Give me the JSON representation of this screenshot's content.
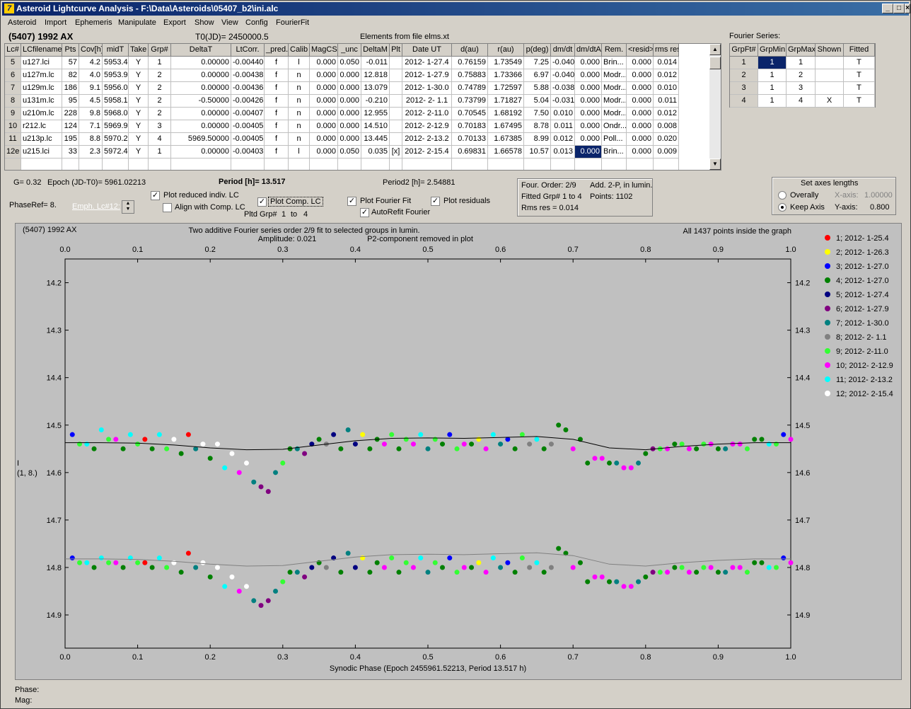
{
  "window": {
    "title": "Asteroid Lightcurve Analysis - F:\\Data\\Asteroids\\05407_b2\\ini.alc",
    "icon_name": "app-icon",
    "minimize": "_",
    "maximize": "□",
    "close": "×"
  },
  "menu": [
    "Asteroid",
    "Import",
    "Ephemeris",
    "Manipulate",
    "Export",
    "Show",
    "View",
    "Config",
    "FourierFit"
  ],
  "header": {
    "asteroid": "(5407) 1992 AX",
    "t0": "T0(JD)= 2450000.5",
    "elements": "Elements from file elms.xt",
    "fourier_series_label": "Fourier Series:"
  },
  "table": {
    "columns": [
      "Lc#",
      "LCfilename",
      "Pts",
      "Cov[h]",
      "midT",
      "Take",
      "Grp#",
      "DeltaT",
      "LtCorr.",
      "_pred.",
      "Calib",
      "MagCS",
      "_unc",
      "DeltaM",
      "Plt",
      "Date UT",
      "d(au)",
      "r(au)",
      "p(deg)",
      "dm/dt",
      "dm/dtA",
      "Rem.",
      "<resid>",
      "rms res"
    ],
    "rows": [
      [
        "5",
        "u127.lci",
        "57",
        "4.2",
        "5953.4",
        "Y",
        "1",
        "0.00000",
        "-0.00440",
        "f",
        "l",
        "0.000",
        "0.050",
        "-0.011",
        "",
        "2012- 1-27.4",
        "0.76159",
        "1.73549",
        "7.25",
        "-0.040",
        "0.000",
        "Brin...",
        "0.000",
        "0.014"
      ],
      [
        "6",
        "u127m.lc",
        "82",
        "4.0",
        "5953.9",
        "Y",
        "2",
        "0.00000",
        "-0.00438",
        "f",
        "n",
        "0.000",
        "0.000",
        "12.818",
        "",
        "2012- 1-27.9",
        "0.75883",
        "1.73366",
        "6.97",
        "-0.040",
        "0.000",
        "Modr...",
        "0.000",
        "0.012"
      ],
      [
        "7",
        "u129m.lc",
        "186",
        "9.1",
        "5956.0",
        "Y",
        "2",
        "0.00000",
        "-0.00436",
        "f",
        "n",
        "0.000",
        "0.000",
        "13.079",
        "",
        "2012- 1-30.0",
        "0.74789",
        "1.72597",
        "5.88",
        "-0.038",
        "0.000",
        "Modr...",
        "0.000",
        "0.010"
      ],
      [
        "8",
        "u131m.lc",
        "95",
        "4.5",
        "5958.1",
        "Y",
        "2",
        "-0.50000",
        "-0.00426",
        "f",
        "n",
        "0.000",
        "0.000",
        "-0.210",
        "",
        "2012- 2- 1.1",
        "0.73799",
        "1.71827",
        "5.04",
        "-0.031",
        "0.000",
        "Modr...",
        "0.000",
        "0.011"
      ],
      [
        "9",
        "u210m.lc",
        "228",
        "9.8",
        "5968.0",
        "Y",
        "2",
        "0.00000",
        "-0.00407",
        "f",
        "n",
        "0.000",
        "0.000",
        "12.955",
        "",
        "2012- 2-11.0",
        "0.70545",
        "1.68192",
        "7.50",
        "0.010",
        "0.000",
        "Modr...",
        "0.000",
        "0.012"
      ],
      [
        "10",
        "r212.lc",
        "124",
        "7.1",
        "5969.9",
        "Y",
        "3",
        "0.00000",
        "-0.00405",
        "f",
        "n",
        "0.000",
        "0.000",
        "14.510",
        "",
        "2012- 2-12.9",
        "0.70183",
        "1.67495",
        "8.78",
        "0.011",
        "0.000",
        "Ondr...",
        "0.000",
        "0.008"
      ],
      [
        "11",
        "u213p.lc",
        "195",
        "8.8",
        "5970.2",
        "Y",
        "4",
        "5969.50000",
        "-0.00405",
        "f",
        "n",
        "0.000",
        "0.000",
        "13.445",
        "",
        "2012- 2-13.2",
        "0.70133",
        "1.67385",
        "8.99",
        "0.012",
        "0.000",
        "Poll...",
        "0.000",
        "0.020"
      ],
      [
        "12e",
        "u215.lci",
        "33",
        "2.3",
        "5972.4",
        "Y",
        "1",
        "0.00000",
        "-0.00403",
        "f",
        "l",
        "0.000",
        "0.050",
        "0.035",
        "[x]",
        "2012- 2-15.4",
        "0.69831",
        "1.66578",
        "10.57",
        "0.013",
        "0.000",
        "Brin...",
        "0.000",
        "0.009"
      ]
    ]
  },
  "fourier": {
    "columns": [
      "GrpFt#",
      "GrpMin",
      "GrpMax",
      "Shown",
      "Fitted"
    ],
    "rows": [
      [
        "1",
        "1",
        "1",
        "",
        "T"
      ],
      [
        "2",
        "1",
        "2",
        "",
        "T"
      ],
      [
        "3",
        "1",
        "3",
        "",
        "T"
      ],
      [
        "4",
        "1",
        "4",
        "X",
        "T"
      ]
    ]
  },
  "params": {
    "g": "G= 0.32",
    "epoch": "Epoch (JD-T0)= 5961.02213",
    "period": "Period [h]= 13.517",
    "period2": "Period2 [h]= 2.54881",
    "phase_ref": "PhaseRef= 8.",
    "emph": "Emph. Lc#12:",
    "pltd": "Pltd Grp#",
    "pltd_from": "1",
    "pltd_to_word": "to",
    "pltd_to": "4",
    "plot_reduced": "Plot reduced indiv. LC",
    "align": "Align with Comp. LC",
    "plot_comp": "Plot Comp. LC",
    "plot_fourier": "Plot Fourier Fit",
    "autorefit": "AutoRefit Fourier",
    "plot_residuals": "Plot residuals"
  },
  "info": {
    "four_order": "Four. Order:  2/9",
    "add": "Add. 2-P, in lumin.",
    "fitted": "Fitted Grp# 1 to 4",
    "points": "Points: 1102",
    "rms": "Rms res      = 0.014"
  },
  "axes_box": {
    "title": "Set axes lengths",
    "overally": "Overally",
    "keep": "Keep Axis",
    "xaxis": "X-axis:",
    "xval": "1.00000",
    "yaxis": "Y-axis:",
    "yval": "0.800"
  },
  "chart_data": {
    "type": "scatter",
    "title": "Two additive Fourier series order 2/9 fit to selected groups in lumin.",
    "subtitle_left": "Amplitude: 0.021",
    "subtitle_right": "P2-component removed in plot",
    "corner_left": "(5407) 1992 AX",
    "corner_right": "All 1437 points inside the graph",
    "xlabel": "Synodic Phase (Epoch 2455961.52213, Period 13.517 h)",
    "ylabel": "I",
    "ylabel2": "(1, 8.)",
    "xlim": [
      0,
      1
    ],
    "ylim": [
      14.15,
      14.97
    ],
    "x_ticks": [
      "0.0",
      "0.1",
      "0.2",
      "0.3",
      "0.4",
      "0.5",
      "0.6",
      "0.7",
      "0.8",
      "0.9",
      "1.0"
    ],
    "y_ticks": [
      "14.2",
      "14.3",
      "14.4",
      "14.5",
      "14.6",
      "14.7",
      "14.8",
      "14.9"
    ],
    "series": [
      {
        "name": "1; 2012- 1-25.4",
        "color": "#ff0000"
      },
      {
        "name": "2; 2012- 1-26.3",
        "color": "#ffff00"
      },
      {
        "name": "3; 2012- 1-27.0",
        "color": "#0000ff"
      },
      {
        "name": "4; 2012- 1-27.0",
        "color": "#008000"
      },
      {
        "name": "5; 2012- 1-27.4",
        "color": "#000080"
      },
      {
        "name": "6; 2012- 1-27.9",
        "color": "#800080"
      },
      {
        "name": "7; 2012- 1-30.0",
        "color": "#008080"
      },
      {
        "name": "8; 2012- 2- 1.1",
        "color": "#808080"
      },
      {
        "name": "9; 2012- 2-11.0",
        "color": "#33ff33"
      },
      {
        "name": "10; 2012- 2-12.9",
        "color": "#ff00ff"
      },
      {
        "name": "11; 2012- 2-13.2",
        "color": "#00ffff"
      },
      {
        "name": "12; 2012- 2-15.4",
        "color": "#ffffff"
      }
    ],
    "fit_curve": {
      "x": [
        0,
        0.05,
        0.1,
        0.15,
        0.2,
        0.25,
        0.3,
        0.35,
        0.4,
        0.45,
        0.5,
        0.55,
        0.6,
        0.65,
        0.7,
        0.75,
        0.8,
        0.85,
        0.9,
        0.95,
        1.0
      ],
      "y": [
        14.537,
        14.537,
        14.538,
        14.542,
        14.548,
        14.552,
        14.551,
        14.542,
        14.533,
        14.528,
        14.527,
        14.528,
        14.526,
        14.524,
        14.53,
        14.548,
        14.552,
        14.545,
        14.54,
        14.537,
        14.537
      ]
    },
    "points": [
      [
        0.01,
        14.52,
        3
      ],
      [
        0.03,
        14.54,
        11
      ],
      [
        0.05,
        14.51,
        11
      ],
      [
        0.07,
        14.53,
        10
      ],
      [
        0.09,
        14.52,
        11
      ],
      [
        0.11,
        14.53,
        1
      ],
      [
        0.13,
        14.52,
        11
      ],
      [
        0.15,
        14.53,
        12
      ],
      [
        0.17,
        14.52,
        1
      ],
      [
        0.19,
        14.54,
        12
      ],
      [
        0.21,
        14.54,
        12
      ],
      [
        0.23,
        14.56,
        12
      ],
      [
        0.25,
        14.58,
        12
      ],
      [
        0.26,
        14.62,
        7
      ],
      [
        0.27,
        14.63,
        6
      ],
      [
        0.29,
        14.6,
        7
      ],
      [
        0.31,
        14.55,
        4
      ],
      [
        0.33,
        14.56,
        6
      ],
      [
        0.35,
        14.53,
        4
      ],
      [
        0.37,
        14.52,
        5
      ],
      [
        0.39,
        14.51,
        7
      ],
      [
        0.41,
        14.52,
        2
      ],
      [
        0.43,
        14.53,
        4
      ],
      [
        0.45,
        14.52,
        9
      ],
      [
        0.47,
        14.53,
        9
      ],
      [
        0.49,
        14.52,
        11
      ],
      [
        0.51,
        14.53,
        9
      ],
      [
        0.53,
        14.52,
        3
      ],
      [
        0.55,
        14.54,
        10
      ],
      [
        0.57,
        14.53,
        2
      ],
      [
        0.59,
        14.52,
        11
      ],
      [
        0.61,
        14.53,
        3
      ],
      [
        0.63,
        14.52,
        9
      ],
      [
        0.65,
        14.53,
        11
      ],
      [
        0.67,
        14.54,
        8
      ],
      [
        0.69,
        14.51,
        4
      ],
      [
        0.71,
        14.53,
        4
      ],
      [
        0.73,
        14.57,
        10
      ],
      [
        0.75,
        14.58,
        4
      ],
      [
        0.77,
        14.59,
        10
      ],
      [
        0.79,
        14.58,
        7
      ],
      [
        0.81,
        14.55,
        6
      ],
      [
        0.83,
        14.55,
        10
      ],
      [
        0.85,
        14.54,
        9
      ],
      [
        0.87,
        14.55,
        4
      ],
      [
        0.89,
        14.54,
        10
      ],
      [
        0.91,
        14.55,
        7
      ],
      [
        0.93,
        14.54,
        10
      ],
      [
        0.95,
        14.53,
        4
      ],
      [
        0.97,
        14.54,
        11
      ],
      [
        0.99,
        14.52,
        3
      ],
      [
        0.02,
        14.54,
        9
      ],
      [
        0.04,
        14.55,
        4
      ],
      [
        0.06,
        14.53,
        9
      ],
      [
        0.08,
        14.55,
        4
      ],
      [
        0.1,
        14.54,
        9
      ],
      [
        0.12,
        14.55,
        4
      ],
      [
        0.14,
        14.55,
        9
      ],
      [
        0.16,
        14.56,
        4
      ],
      [
        0.18,
        14.55,
        7
      ],
      [
        0.2,
        14.57,
        4
      ],
      [
        0.22,
        14.59,
        11
      ],
      [
        0.24,
        14.6,
        10
      ],
      [
        0.28,
        14.64,
        6
      ],
      [
        0.3,
        14.58,
        9
      ],
      [
        0.32,
        14.55,
        7
      ],
      [
        0.34,
        14.54,
        5
      ],
      [
        0.36,
        14.54,
        8
      ],
      [
        0.38,
        14.55,
        4
      ],
      [
        0.4,
        14.54,
        5
      ],
      [
        0.42,
        14.55,
        4
      ],
      [
        0.44,
        14.54,
        10
      ],
      [
        0.46,
        14.55,
        4
      ],
      [
        0.48,
        14.54,
        10
      ],
      [
        0.5,
        14.55,
        7
      ],
      [
        0.52,
        14.54,
        4
      ],
      [
        0.54,
        14.55,
        9
      ],
      [
        0.56,
        14.54,
        4
      ],
      [
        0.58,
        14.55,
        10
      ],
      [
        0.6,
        14.54,
        7
      ],
      [
        0.62,
        14.55,
        4
      ],
      [
        0.64,
        14.54,
        8
      ],
      [
        0.66,
        14.55,
        4
      ],
      [
        0.68,
        14.5,
        4
      ],
      [
        0.7,
        14.55,
        10
      ],
      [
        0.72,
        14.58,
        4
      ],
      [
        0.74,
        14.57,
        10
      ],
      [
        0.76,
        14.58,
        7
      ],
      [
        0.78,
        14.59,
        10
      ],
      [
        0.8,
        14.56,
        4
      ],
      [
        0.82,
        14.55,
        9
      ],
      [
        0.84,
        14.54,
        4
      ],
      [
        0.86,
        14.55,
        10
      ],
      [
        0.88,
        14.54,
        9
      ],
      [
        0.9,
        14.55,
        4
      ],
      [
        0.92,
        14.54,
        10
      ],
      [
        0.94,
        14.55,
        9
      ],
      [
        0.96,
        14.53,
        4
      ],
      [
        0.98,
        14.54,
        9
      ],
      [
        1.0,
        14.53,
        10
      ],
      [
        0.01,
        14.78,
        3
      ],
      [
        0.03,
        14.79,
        11
      ],
      [
        0.05,
        14.78,
        11
      ],
      [
        0.07,
        14.79,
        10
      ],
      [
        0.09,
        14.78,
        11
      ],
      [
        0.11,
        14.79,
        1
      ],
      [
        0.13,
        14.78,
        11
      ],
      [
        0.15,
        14.79,
        12
      ],
      [
        0.17,
        14.77,
        1
      ],
      [
        0.19,
        14.79,
        12
      ],
      [
        0.21,
        14.8,
        12
      ],
      [
        0.23,
        14.82,
        12
      ],
      [
        0.25,
        14.84,
        12
      ],
      [
        0.26,
        14.87,
        7
      ],
      [
        0.27,
        14.88,
        6
      ],
      [
        0.29,
        14.85,
        7
      ],
      [
        0.31,
        14.81,
        4
      ],
      [
        0.33,
        14.82,
        6
      ],
      [
        0.35,
        14.79,
        4
      ],
      [
        0.37,
        14.78,
        5
      ],
      [
        0.39,
        14.77,
        7
      ],
      [
        0.41,
        14.78,
        2
      ],
      [
        0.43,
        14.79,
        4
      ],
      [
        0.45,
        14.78,
        9
      ],
      [
        0.47,
        14.79,
        9
      ],
      [
        0.49,
        14.78,
        11
      ],
      [
        0.51,
        14.79,
        9
      ],
      [
        0.53,
        14.78,
        3
      ],
      [
        0.55,
        14.8,
        10
      ],
      [
        0.57,
        14.79,
        2
      ],
      [
        0.59,
        14.78,
        11
      ],
      [
        0.61,
        14.79,
        3
      ],
      [
        0.63,
        14.78,
        9
      ],
      [
        0.65,
        14.79,
        11
      ],
      [
        0.67,
        14.8,
        8
      ],
      [
        0.69,
        14.77,
        4
      ],
      [
        0.71,
        14.79,
        4
      ],
      [
        0.73,
        14.82,
        10
      ],
      [
        0.75,
        14.83,
        4
      ],
      [
        0.77,
        14.84,
        10
      ],
      [
        0.79,
        14.83,
        7
      ],
      [
        0.81,
        14.81,
        6
      ],
      [
        0.83,
        14.81,
        10
      ],
      [
        0.85,
        14.8,
        9
      ],
      [
        0.87,
        14.81,
        4
      ],
      [
        0.89,
        14.8,
        10
      ],
      [
        0.91,
        14.81,
        7
      ],
      [
        0.93,
        14.8,
        10
      ],
      [
        0.95,
        14.79,
        4
      ],
      [
        0.97,
        14.8,
        11
      ],
      [
        0.99,
        14.78,
        3
      ],
      [
        0.02,
        14.79,
        9
      ],
      [
        0.04,
        14.8,
        4
      ],
      [
        0.06,
        14.79,
        9
      ],
      [
        0.08,
        14.8,
        4
      ],
      [
        0.1,
        14.79,
        9
      ],
      [
        0.12,
        14.8,
        4
      ],
      [
        0.14,
        14.8,
        9
      ],
      [
        0.16,
        14.81,
        4
      ],
      [
        0.18,
        14.8,
        7
      ],
      [
        0.2,
        14.82,
        4
      ],
      [
        0.22,
        14.84,
        11
      ],
      [
        0.24,
        14.85,
        10
      ],
      [
        0.28,
        14.87,
        6
      ],
      [
        0.3,
        14.83,
        9
      ],
      [
        0.32,
        14.81,
        7
      ],
      [
        0.34,
        14.8,
        5
      ],
      [
        0.36,
        14.8,
        8
      ],
      [
        0.38,
        14.81,
        4
      ],
      [
        0.4,
        14.8,
        5
      ],
      [
        0.42,
        14.81,
        4
      ],
      [
        0.44,
        14.8,
        10
      ],
      [
        0.46,
        14.81,
        4
      ],
      [
        0.48,
        14.8,
        10
      ],
      [
        0.5,
        14.81,
        7
      ],
      [
        0.52,
        14.8,
        4
      ],
      [
        0.54,
        14.81,
        9
      ],
      [
        0.56,
        14.8,
        4
      ],
      [
        0.58,
        14.81,
        10
      ],
      [
        0.6,
        14.8,
        7
      ],
      [
        0.62,
        14.81,
        4
      ],
      [
        0.64,
        14.8,
        8
      ],
      [
        0.66,
        14.81,
        4
      ],
      [
        0.68,
        14.76,
        4
      ],
      [
        0.7,
        14.8,
        10
      ],
      [
        0.72,
        14.83,
        4
      ],
      [
        0.74,
        14.82,
        10
      ],
      [
        0.76,
        14.83,
        7
      ],
      [
        0.78,
        14.84,
        10
      ],
      [
        0.8,
        14.82,
        4
      ],
      [
        0.82,
        14.81,
        9
      ],
      [
        0.84,
        14.8,
        4
      ],
      [
        0.86,
        14.81,
        10
      ],
      [
        0.88,
        14.8,
        9
      ],
      [
        0.9,
        14.81,
        4
      ],
      [
        0.92,
        14.8,
        10
      ],
      [
        0.94,
        14.81,
        9
      ],
      [
        0.96,
        14.79,
        4
      ],
      [
        0.98,
        14.8,
        9
      ],
      [
        1.0,
        14.79,
        10
      ]
    ]
  },
  "status": {
    "phase": "Phase:",
    "mag": "Mag:"
  }
}
